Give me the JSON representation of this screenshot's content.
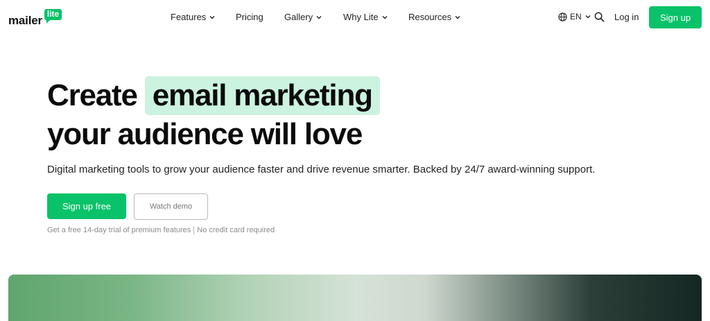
{
  "header": {
    "logo": {
      "word": "mailer",
      "badge": "lite"
    },
    "nav": [
      {
        "label": "Features",
        "has_dropdown": true
      },
      {
        "label": "Pricing",
        "has_dropdown": false
      },
      {
        "label": "Gallery",
        "has_dropdown": true
      },
      {
        "label": "Why Lite",
        "has_dropdown": true
      },
      {
        "label": "Resources",
        "has_dropdown": true
      }
    ],
    "language": {
      "label": "EN",
      "icon": "globe-icon"
    },
    "search_icon": "search-icon",
    "login_label": "Log in",
    "signup_label": "Sign up"
  },
  "hero": {
    "title_prefix": "Create",
    "title_highlight": "email marketing",
    "title_line2": "your audience will love",
    "subtitle": "Digital marketing tools to grow your audience faster and drive revenue smarter. Backed by 24/7 award-winning support.",
    "primary_cta": "Sign up free",
    "secondary_cta": "Watch demo",
    "note_part1": "Get a free 14-day trial of premium features",
    "note_part2": "No credit card required"
  },
  "colors": {
    "brand_green": "#09c269",
    "highlight_bg": "#ccf3df"
  }
}
